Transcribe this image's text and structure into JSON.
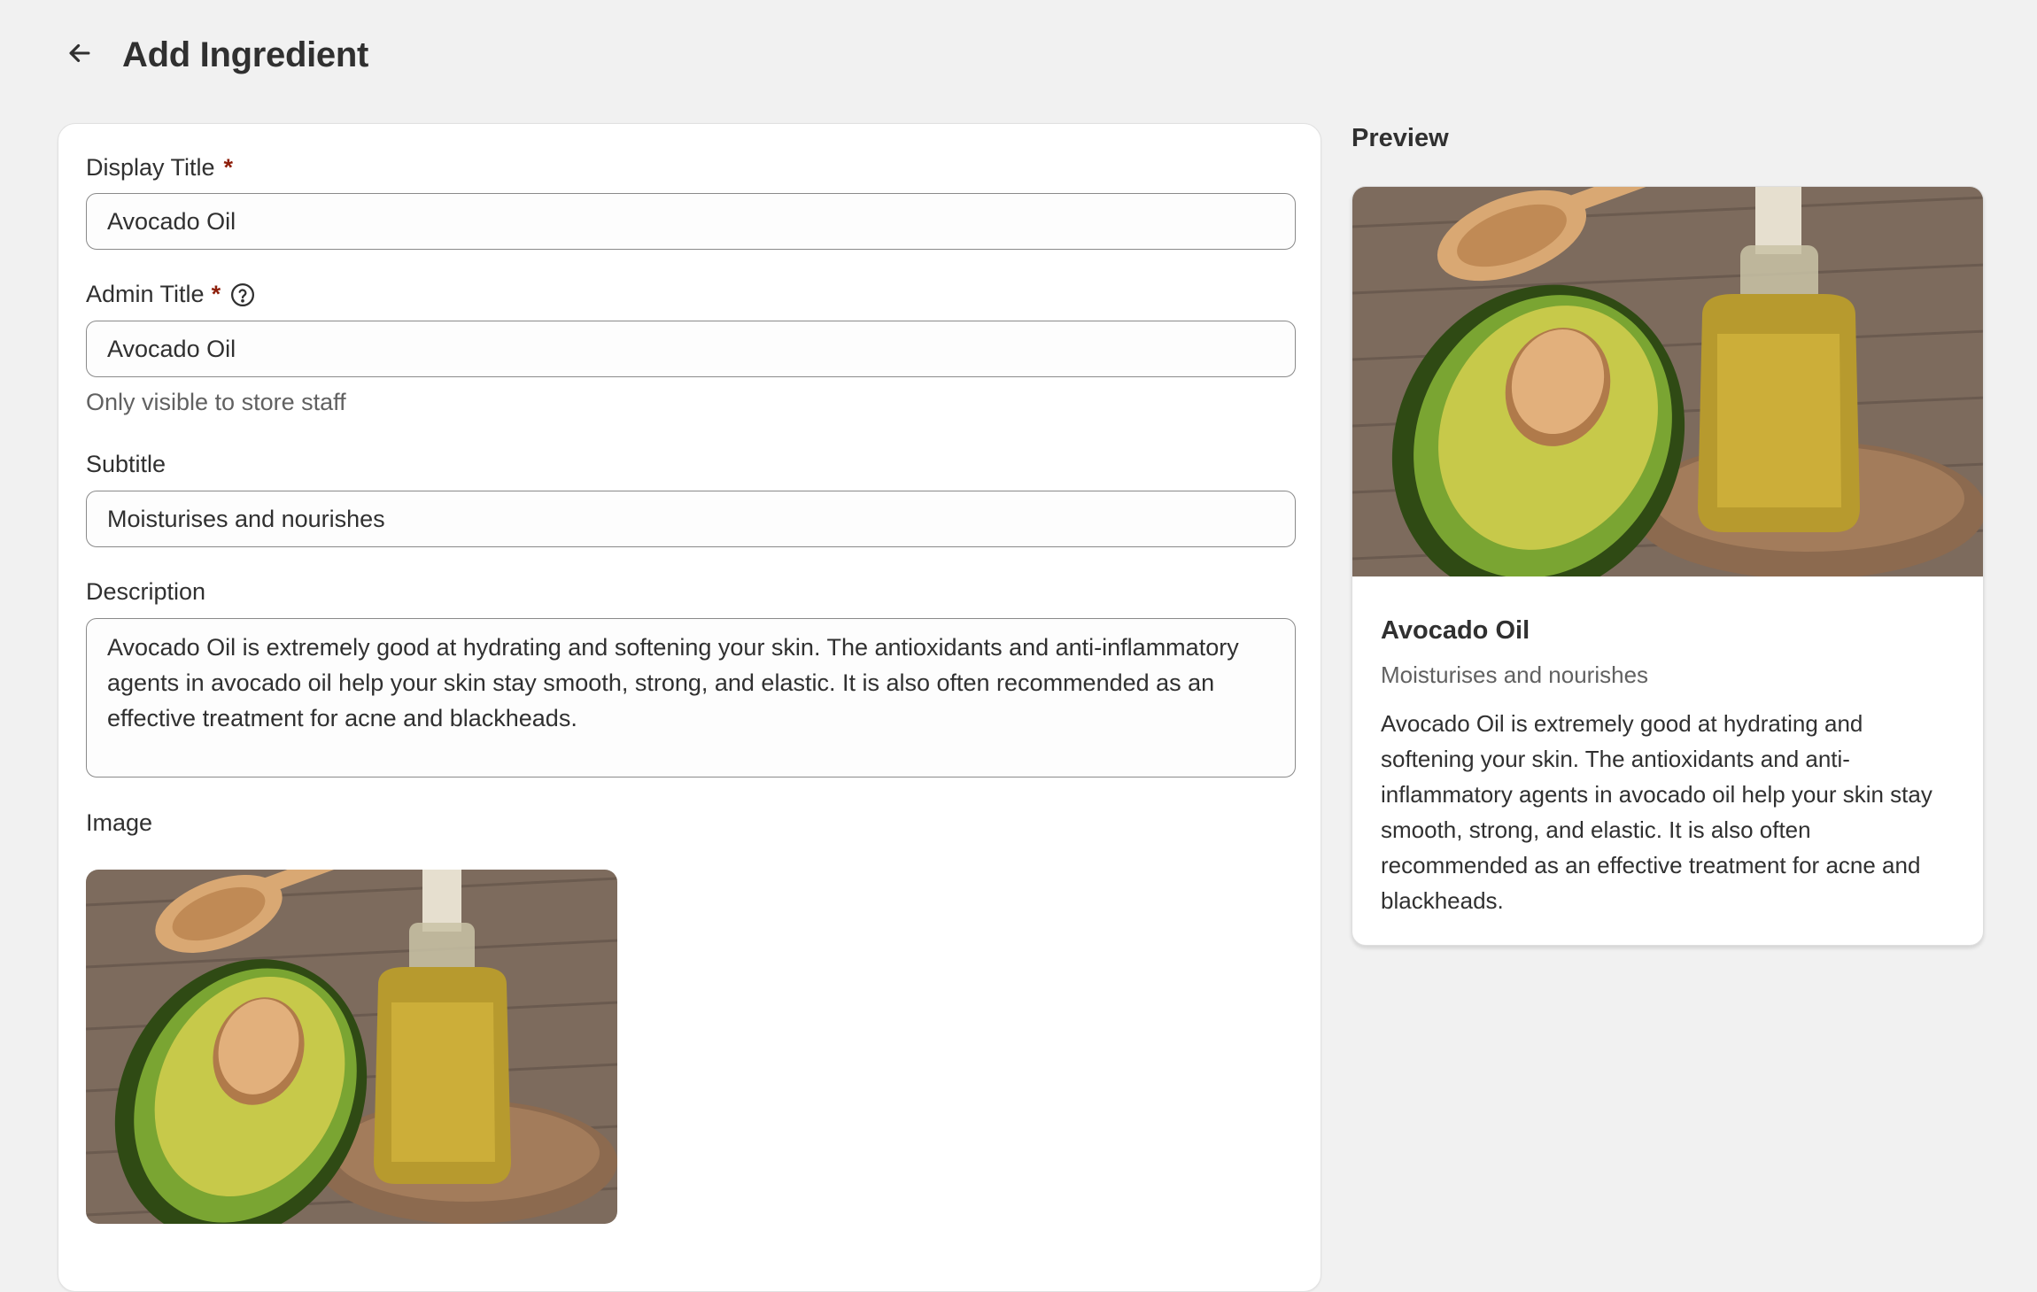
{
  "header": {
    "title": "Add Ingredient",
    "back_icon": "arrow-left-icon"
  },
  "form": {
    "display_title": {
      "label": "Display Title",
      "required_mark": "*",
      "value": "Avocado Oil"
    },
    "admin_title": {
      "label": "Admin Title",
      "required_mark": "*",
      "help_icon": "question-circle-icon",
      "value": "Avocado Oil",
      "help_text": "Only visible to store staff"
    },
    "subtitle": {
      "label": "Subtitle",
      "value": "Moisturises and nourishes"
    },
    "description": {
      "label": "Description",
      "value": "Avocado Oil is extremely good at hydrating and softening your skin. The antioxidants and anti-inflammatory agents in avocado oil help your skin stay smooth, strong, and elastic. It is also often recommended as an effective treatment for acne and blackheads."
    },
    "image": {
      "label": "Image"
    }
  },
  "preview": {
    "heading": "Preview",
    "title": "Avocado Oil",
    "subtitle": "Moisturises and nourishes",
    "description": "Avocado Oil is extremely good at hydrating and softening your skin. The antioxidants and anti-inflammatory agents in avocado oil help your skin stay smooth, strong, and elastic. It is also often recommended as an effective treatment for acne and blackheads."
  },
  "colors": {
    "page_bg": "#f1f1f1",
    "card_bg": "#ffffff",
    "required": "#8e1f0b",
    "text": "#303030",
    "muted_text": "#616161"
  }
}
